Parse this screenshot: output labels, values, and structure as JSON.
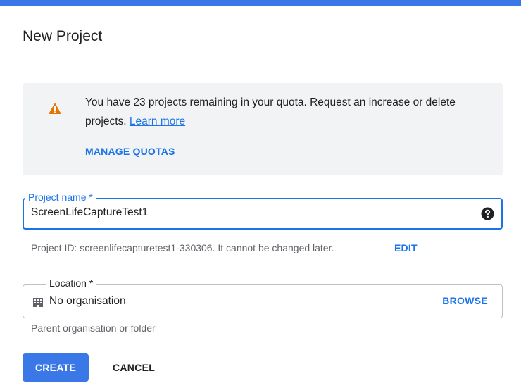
{
  "header": {
    "title": "New Project"
  },
  "quota_notice": {
    "icon": "warning-icon",
    "message": "You have 23 projects remaining in your quota. Request an increase or delete projects. ",
    "learn_more_label": "Learn more",
    "manage_quotas_label": "MANAGE QUOTAS"
  },
  "project_name": {
    "label": "Project name *",
    "value": "ScreenLifeCaptureTest1",
    "help_icon": "help-icon",
    "project_id_hint": "Project ID: screenlifecapturetest1-330306. It cannot be changed later.",
    "edit_label": "EDIT"
  },
  "location": {
    "label": "Location *",
    "icon": "building-icon",
    "value": "No organisation",
    "browse_label": "BROWSE",
    "hint": "Parent organisation or folder"
  },
  "actions": {
    "create_label": "CREATE",
    "cancel_label": "CANCEL"
  },
  "colors": {
    "accent": "#1a73e8",
    "primary_button": "#3b78e7",
    "warning": "#e37400",
    "notice_background": "#f1f3f4"
  }
}
